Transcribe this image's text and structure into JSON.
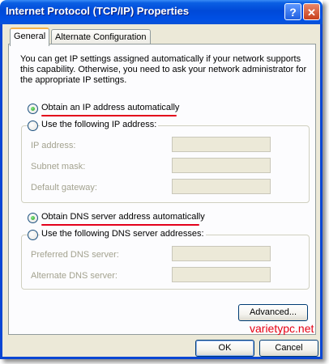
{
  "window": {
    "title": "Internet Protocol (TCP/IP) Properties",
    "help_label": "?",
    "close_label": "✕"
  },
  "tabs": [
    {
      "label": "General",
      "active": true
    },
    {
      "label": "Alternate Configuration",
      "active": false
    }
  ],
  "description": "You can get IP settings assigned automatically if your network supports this capability. Otherwise, you need to ask your network administrator for the appropriate IP settings.",
  "ip_section": {
    "auto_option": "Obtain an IP address automatically",
    "manual_option": "Use the following IP address:",
    "selected": "auto",
    "fields": [
      {
        "label": "IP address:",
        "value": ""
      },
      {
        "label": "Subnet mask:",
        "value": ""
      },
      {
        "label": "Default gateway:",
        "value": ""
      }
    ]
  },
  "dns_section": {
    "auto_option": "Obtain DNS server address automatically",
    "manual_option": "Use the following DNS server addresses:",
    "selected": "auto",
    "fields": [
      {
        "label": "Preferred DNS server:",
        "value": ""
      },
      {
        "label": "Alternate DNS server:",
        "value": ""
      }
    ]
  },
  "buttons": {
    "advanced": "Advanced...",
    "ok": "OK",
    "cancel": "Cancel"
  },
  "watermark": "varietypc.net",
  "colors": {
    "title_bar": "#0054e3",
    "dialog_bg": "#ece9d8",
    "highlight_underline": "#e3001b",
    "watermark": "#e60012"
  }
}
